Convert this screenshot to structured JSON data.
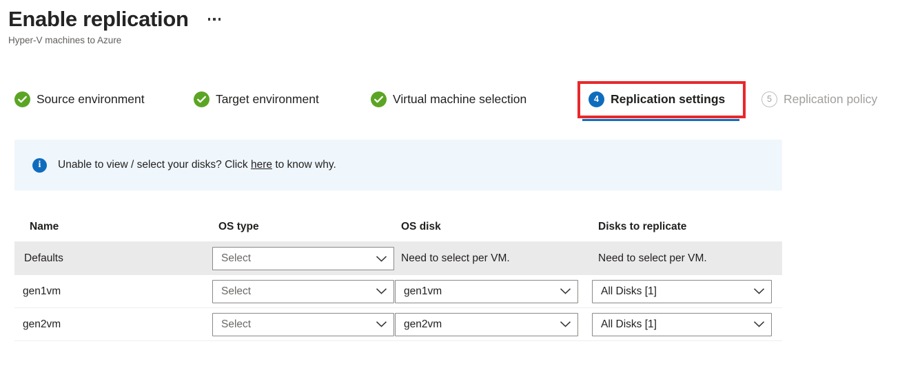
{
  "header": {
    "title": "Enable replication",
    "subtitle": "Hyper-V machines to Azure",
    "more_label": "..."
  },
  "steps": [
    {
      "label": "Source environment",
      "badge": "check",
      "state": "complete"
    },
    {
      "label": "Target environment",
      "badge": "check",
      "state": "complete"
    },
    {
      "label": "Virtual machine selection",
      "badge": "check",
      "state": "complete"
    },
    {
      "label": "Replication settings",
      "badge": "4",
      "state": "active"
    },
    {
      "label": "Replication policy",
      "badge": "5",
      "state": "disabled"
    }
  ],
  "banner": {
    "text_before": "Unable to view / select your disks? Click",
    "link": "here",
    "text_after": "to know why."
  },
  "table": {
    "columns": [
      "Name",
      "OS type",
      "OS disk",
      "Disks to replicate"
    ],
    "rows": [
      {
        "name": "Defaults",
        "os_type": "Select",
        "os_type_kind": "dropdown-placeholder",
        "os_disk": "Need to select per VM.",
        "os_disk_kind": "text",
        "disks": "Need to select per VM.",
        "disks_kind": "text"
      },
      {
        "name": "gen1vm",
        "os_type": "Select",
        "os_type_kind": "dropdown-placeholder",
        "os_disk": "gen1vm",
        "os_disk_kind": "dropdown",
        "disks": "All Disks [1]",
        "disks_kind": "dropdown"
      },
      {
        "name": "gen2vm",
        "os_type": "Select",
        "os_type_kind": "dropdown-placeholder",
        "os_disk": "gen2vm",
        "os_disk_kind": "dropdown",
        "disks": "All Disks [1]",
        "disks_kind": "dropdown"
      }
    ]
  },
  "colors": {
    "accent": "#0f6cbd",
    "complete": "#5ba524",
    "highlight": "#e8282b",
    "banner_bg": "#eff6fc",
    "row_alt_bg": "#ebeaea"
  }
}
